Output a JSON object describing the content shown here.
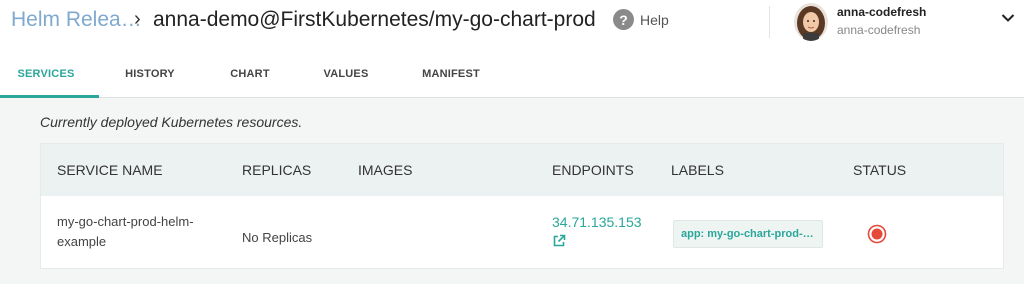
{
  "breadcrumb": {
    "root": "Helm Relea…",
    "separator": "›",
    "current": "anna-demo@FirstKubernetes/my-go-chart-prod"
  },
  "header": {
    "help_label": "Help",
    "user_name": "anna-codefresh",
    "user_sub": "anna-codefresh"
  },
  "tabs": [
    {
      "label": "SERVICES",
      "active": true
    },
    {
      "label": "HISTORY",
      "active": false
    },
    {
      "label": "CHART",
      "active": false
    },
    {
      "label": "VALUES",
      "active": false
    },
    {
      "label": "MANIFEST",
      "active": false
    }
  ],
  "content": {
    "caption": "Currently deployed Kubernetes resources."
  },
  "table": {
    "columns": [
      "SERVICE NAME",
      "REPLICAS",
      "IMAGES",
      "ENDPOINTS",
      "LABELS",
      "STATUS"
    ],
    "rows": [
      {
        "service_name": "my-go-chart-prod-helm-example",
        "replicas": "No Replicas",
        "images": "",
        "endpoint": "34.71.135.153",
        "label": "app: my-go-chart-prod-…",
        "status": "error"
      }
    ]
  },
  "colors": {
    "accent": "#2aa69a",
    "breadcrumb_root": "#7fa9cf",
    "status_error": "#e5493a"
  }
}
